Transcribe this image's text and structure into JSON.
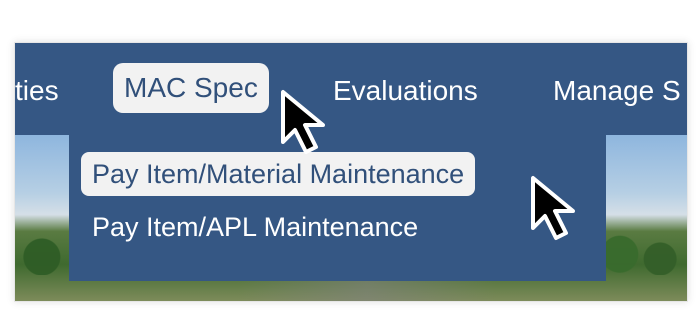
{
  "navbar": {
    "items": [
      {
        "label": "ties"
      },
      {
        "label": "MAC Spec"
      },
      {
        "label": "Evaluations"
      },
      {
        "label": "Manage S"
      }
    ]
  },
  "dropdown": {
    "items": [
      {
        "label": "Pay Item/Material Maintenance"
      },
      {
        "label": "Pay Item/APL Maintenance"
      }
    ]
  },
  "colors": {
    "nav_background": "#355784",
    "selected_background": "#f2f2f2",
    "selected_text": "#31507a",
    "text": "#ffffff"
  },
  "icons": {
    "cursor_1": "mouse-pointer-icon",
    "cursor_2": "mouse-pointer-icon"
  }
}
